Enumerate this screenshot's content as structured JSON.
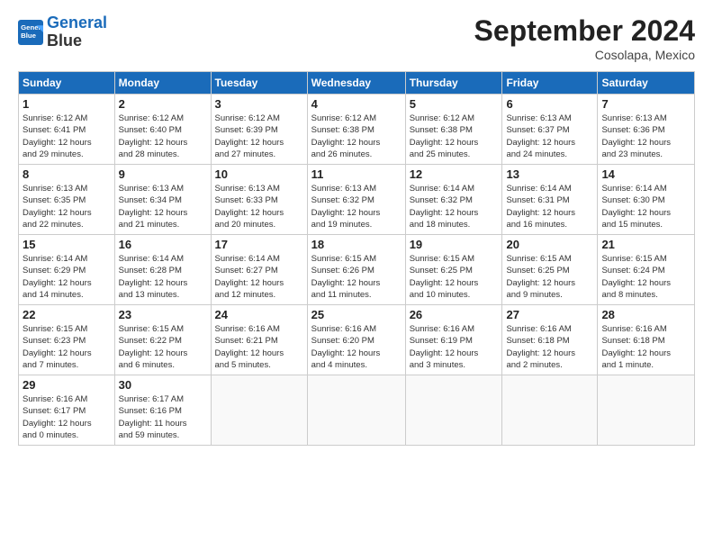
{
  "header": {
    "logo_line1": "General",
    "logo_line2": "Blue",
    "month": "September 2024",
    "location": "Cosolapa, Mexico"
  },
  "weekdays": [
    "Sunday",
    "Monday",
    "Tuesday",
    "Wednesday",
    "Thursday",
    "Friday",
    "Saturday"
  ],
  "weeks": [
    [
      {
        "day": "1",
        "info": "Sunrise: 6:12 AM\nSunset: 6:41 PM\nDaylight: 12 hours\nand 29 minutes."
      },
      {
        "day": "2",
        "info": "Sunrise: 6:12 AM\nSunset: 6:40 PM\nDaylight: 12 hours\nand 28 minutes."
      },
      {
        "day": "3",
        "info": "Sunrise: 6:12 AM\nSunset: 6:39 PM\nDaylight: 12 hours\nand 27 minutes."
      },
      {
        "day": "4",
        "info": "Sunrise: 6:12 AM\nSunset: 6:38 PM\nDaylight: 12 hours\nand 26 minutes."
      },
      {
        "day": "5",
        "info": "Sunrise: 6:12 AM\nSunset: 6:38 PM\nDaylight: 12 hours\nand 25 minutes."
      },
      {
        "day": "6",
        "info": "Sunrise: 6:13 AM\nSunset: 6:37 PM\nDaylight: 12 hours\nand 24 minutes."
      },
      {
        "day": "7",
        "info": "Sunrise: 6:13 AM\nSunset: 6:36 PM\nDaylight: 12 hours\nand 23 minutes."
      }
    ],
    [
      {
        "day": "8",
        "info": "Sunrise: 6:13 AM\nSunset: 6:35 PM\nDaylight: 12 hours\nand 22 minutes."
      },
      {
        "day": "9",
        "info": "Sunrise: 6:13 AM\nSunset: 6:34 PM\nDaylight: 12 hours\nand 21 minutes."
      },
      {
        "day": "10",
        "info": "Sunrise: 6:13 AM\nSunset: 6:33 PM\nDaylight: 12 hours\nand 20 minutes."
      },
      {
        "day": "11",
        "info": "Sunrise: 6:13 AM\nSunset: 6:32 PM\nDaylight: 12 hours\nand 19 minutes."
      },
      {
        "day": "12",
        "info": "Sunrise: 6:14 AM\nSunset: 6:32 PM\nDaylight: 12 hours\nand 18 minutes."
      },
      {
        "day": "13",
        "info": "Sunrise: 6:14 AM\nSunset: 6:31 PM\nDaylight: 12 hours\nand 16 minutes."
      },
      {
        "day": "14",
        "info": "Sunrise: 6:14 AM\nSunset: 6:30 PM\nDaylight: 12 hours\nand 15 minutes."
      }
    ],
    [
      {
        "day": "15",
        "info": "Sunrise: 6:14 AM\nSunset: 6:29 PM\nDaylight: 12 hours\nand 14 minutes."
      },
      {
        "day": "16",
        "info": "Sunrise: 6:14 AM\nSunset: 6:28 PM\nDaylight: 12 hours\nand 13 minutes."
      },
      {
        "day": "17",
        "info": "Sunrise: 6:14 AM\nSunset: 6:27 PM\nDaylight: 12 hours\nand 12 minutes."
      },
      {
        "day": "18",
        "info": "Sunrise: 6:15 AM\nSunset: 6:26 PM\nDaylight: 12 hours\nand 11 minutes."
      },
      {
        "day": "19",
        "info": "Sunrise: 6:15 AM\nSunset: 6:25 PM\nDaylight: 12 hours\nand 10 minutes."
      },
      {
        "day": "20",
        "info": "Sunrise: 6:15 AM\nSunset: 6:25 PM\nDaylight: 12 hours\nand 9 minutes."
      },
      {
        "day": "21",
        "info": "Sunrise: 6:15 AM\nSunset: 6:24 PM\nDaylight: 12 hours\nand 8 minutes."
      }
    ],
    [
      {
        "day": "22",
        "info": "Sunrise: 6:15 AM\nSunset: 6:23 PM\nDaylight: 12 hours\nand 7 minutes."
      },
      {
        "day": "23",
        "info": "Sunrise: 6:15 AM\nSunset: 6:22 PM\nDaylight: 12 hours\nand 6 minutes."
      },
      {
        "day": "24",
        "info": "Sunrise: 6:16 AM\nSunset: 6:21 PM\nDaylight: 12 hours\nand 5 minutes."
      },
      {
        "day": "25",
        "info": "Sunrise: 6:16 AM\nSunset: 6:20 PM\nDaylight: 12 hours\nand 4 minutes."
      },
      {
        "day": "26",
        "info": "Sunrise: 6:16 AM\nSunset: 6:19 PM\nDaylight: 12 hours\nand 3 minutes."
      },
      {
        "day": "27",
        "info": "Sunrise: 6:16 AM\nSunset: 6:18 PM\nDaylight: 12 hours\nand 2 minutes."
      },
      {
        "day": "28",
        "info": "Sunrise: 6:16 AM\nSunset: 6:18 PM\nDaylight: 12 hours\nand 1 minute."
      }
    ],
    [
      {
        "day": "29",
        "info": "Sunrise: 6:16 AM\nSunset: 6:17 PM\nDaylight: 12 hours\nand 0 minutes."
      },
      {
        "day": "30",
        "info": "Sunrise: 6:17 AM\nSunset: 6:16 PM\nDaylight: 11 hours\nand 59 minutes."
      },
      {
        "day": "",
        "info": ""
      },
      {
        "day": "",
        "info": ""
      },
      {
        "day": "",
        "info": ""
      },
      {
        "day": "",
        "info": ""
      },
      {
        "day": "",
        "info": ""
      }
    ]
  ]
}
